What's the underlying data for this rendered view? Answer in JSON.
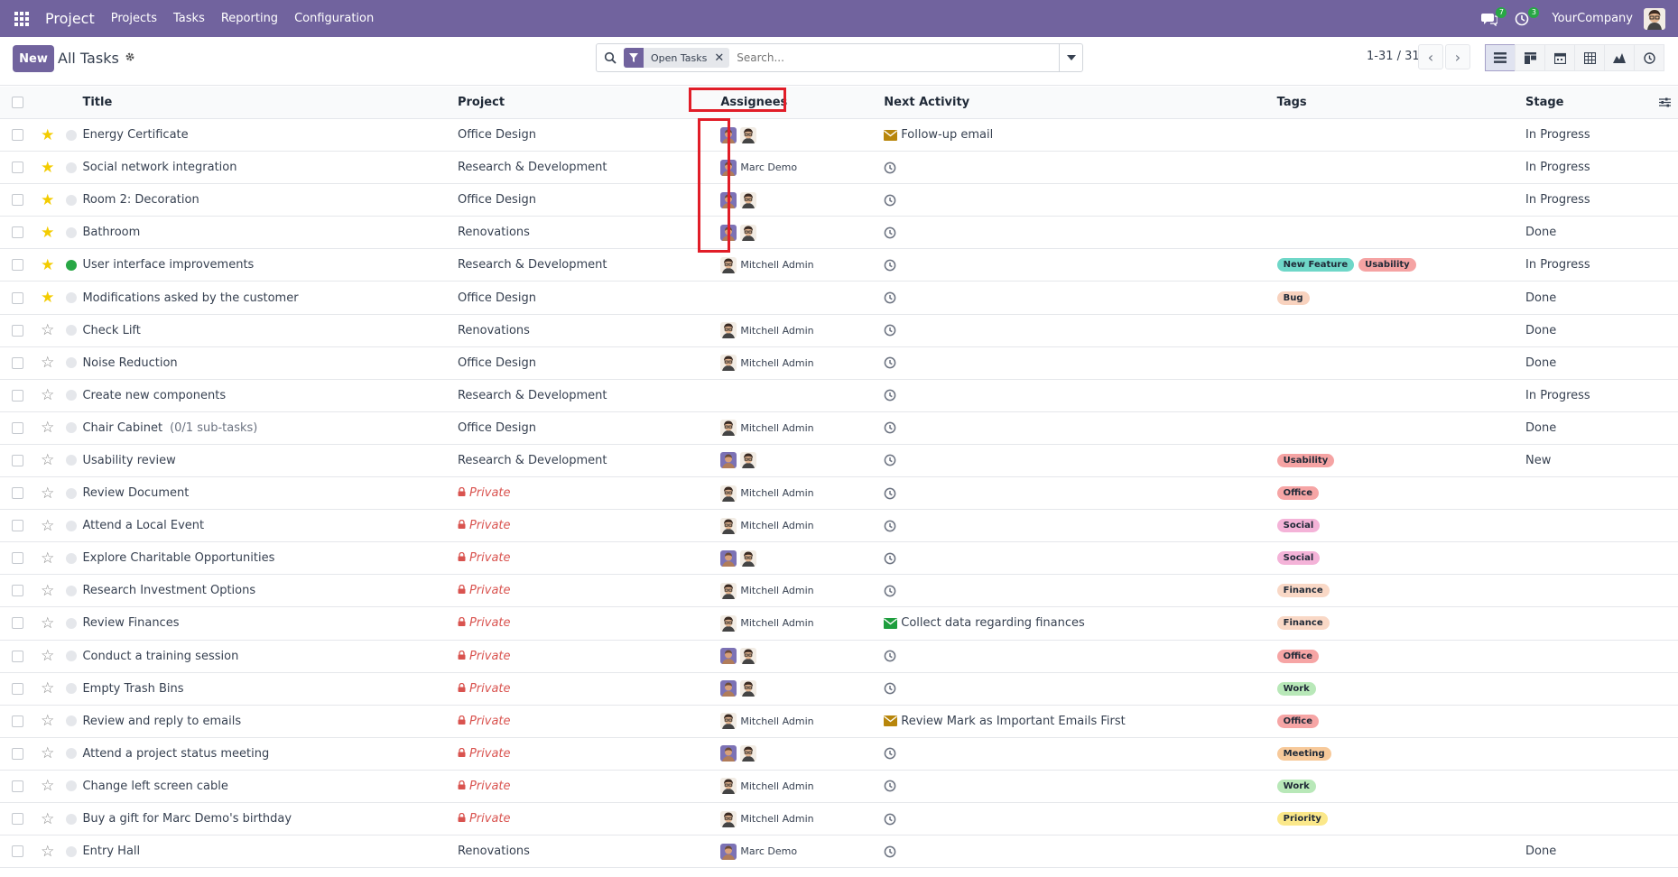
{
  "navbar": {
    "brand": "Project",
    "menu": [
      "Projects",
      "Tasks",
      "Reporting",
      "Configuration"
    ],
    "messages_count": "7",
    "activities_count": "3",
    "company": "YourCompany"
  },
  "control": {
    "new_label": "New",
    "breadcrumb": "All Tasks",
    "facet": "Open Tasks",
    "search_placeholder": "Search...",
    "pager": "1-31 / 31"
  },
  "table": {
    "headers": {
      "title": "Title",
      "project": "Project",
      "assignees": "Assignees",
      "activity": "Next Activity",
      "tags": "Tags",
      "stage": "Stage"
    },
    "rows": [
      {
        "starred": true,
        "state": "grey",
        "title": "Energy Certificate",
        "subtasks": "",
        "project": "Office Design",
        "private": false,
        "assignees": [
          "marc",
          "mitchell"
        ],
        "assignee_name": "",
        "activity": "Follow-up email",
        "activity_type": "mail-warning",
        "tags": [],
        "stage": "In Progress"
      },
      {
        "starred": true,
        "state": "grey",
        "title": "Social network integration",
        "subtasks": "",
        "project": "Research & Development",
        "private": false,
        "assignees": [
          "marc"
        ],
        "assignee_name": "Marc Demo",
        "activity": "",
        "activity_type": "clock",
        "tags": [],
        "stage": "In Progress"
      },
      {
        "starred": true,
        "state": "grey",
        "title": "Room 2: Decoration",
        "subtasks": "",
        "project": "Office Design",
        "private": false,
        "assignees": [
          "marc",
          "mitchell"
        ],
        "assignee_name": "",
        "activity": "",
        "activity_type": "clock",
        "tags": [],
        "stage": "In Progress"
      },
      {
        "starred": true,
        "state": "grey",
        "title": "Bathroom",
        "subtasks": "",
        "project": "Renovations",
        "private": false,
        "assignees": [
          "marc",
          "mitchell"
        ],
        "assignee_name": "",
        "activity": "",
        "activity_type": "clock",
        "tags": [],
        "stage": "Done"
      },
      {
        "starred": true,
        "state": "green",
        "title": "User interface improvements",
        "subtasks": "",
        "project": "Research & Development",
        "private": false,
        "assignees": [
          "mitchell"
        ],
        "assignee_name": "Mitchell Admin",
        "activity": "",
        "activity_type": "clock",
        "tags": [
          {
            "label": "New Feature",
            "color": "#6fd7c8"
          },
          {
            "label": "Usability",
            "color": "#f5a3a3"
          }
        ],
        "stage": "In Progress"
      },
      {
        "starred": true,
        "state": "grey",
        "title": "Modifications asked by the customer",
        "subtasks": "",
        "project": "Office Design",
        "private": false,
        "assignees": [],
        "assignee_name": "",
        "activity": "",
        "activity_type": "clock",
        "tags": [
          {
            "label": "Bug",
            "color": "#f8d2be"
          }
        ],
        "stage": "Done"
      },
      {
        "starred": false,
        "state": "grey",
        "title": "Check Lift",
        "subtasks": "",
        "project": "Renovations",
        "private": false,
        "assignees": [
          "mitchell"
        ],
        "assignee_name": "Mitchell Admin",
        "activity": "",
        "activity_type": "clock",
        "tags": [],
        "stage": "Done"
      },
      {
        "starred": false,
        "state": "grey",
        "title": "Noise Reduction",
        "subtasks": "",
        "project": "Office Design",
        "private": false,
        "assignees": [
          "mitchell"
        ],
        "assignee_name": "Mitchell Admin",
        "activity": "",
        "activity_type": "clock",
        "tags": [],
        "stage": "Done"
      },
      {
        "starred": false,
        "state": "grey",
        "title": "Create new components",
        "subtasks": "",
        "project": "Research & Development",
        "private": false,
        "assignees": [],
        "assignee_name": "",
        "activity": "",
        "activity_type": "clock",
        "tags": [],
        "stage": "In Progress"
      },
      {
        "starred": false,
        "state": "grey",
        "title": "Chair Cabinet",
        "subtasks": "(0/1 sub-tasks)",
        "project": "Office Design",
        "private": false,
        "assignees": [
          "mitchell"
        ],
        "assignee_name": "Mitchell Admin",
        "activity": "",
        "activity_type": "clock",
        "tags": [],
        "stage": "Done"
      },
      {
        "starred": false,
        "state": "grey",
        "title": "Usability review",
        "subtasks": "",
        "project": "Research & Development",
        "private": false,
        "assignees": [
          "marc",
          "mitchell"
        ],
        "assignee_name": "",
        "activity": "",
        "activity_type": "clock",
        "tags": [
          {
            "label": "Usability",
            "color": "#f5a3a3"
          }
        ],
        "stage": "New"
      },
      {
        "starred": false,
        "state": "grey",
        "title": "Review Document",
        "subtasks": "",
        "project": "Private",
        "private": true,
        "assignees": [
          "mitchell"
        ],
        "assignee_name": "Mitchell Admin",
        "activity": "",
        "activity_type": "clock",
        "tags": [
          {
            "label": "Office",
            "color": "#f6a5a5"
          }
        ],
        "stage": ""
      },
      {
        "starred": false,
        "state": "grey",
        "title": "Attend a Local Event",
        "subtasks": "",
        "project": "Private",
        "private": true,
        "assignees": [
          "mitchell"
        ],
        "assignee_name": "Mitchell Admin",
        "activity": "",
        "activity_type": "clock",
        "tags": [
          {
            "label": "Social",
            "color": "#f4b3d8"
          }
        ],
        "stage": ""
      },
      {
        "starred": false,
        "state": "grey",
        "title": "Explore Charitable Opportunities",
        "subtasks": "",
        "project": "Private",
        "private": true,
        "assignees": [
          "marc",
          "mitchell"
        ],
        "assignee_name": "",
        "activity": "",
        "activity_type": "clock",
        "tags": [
          {
            "label": "Social",
            "color": "#f4b3d8"
          }
        ],
        "stage": ""
      },
      {
        "starred": false,
        "state": "grey",
        "title": "Research Investment Options",
        "subtasks": "",
        "project": "Private",
        "private": true,
        "assignees": [
          "mitchell"
        ],
        "assignee_name": "Mitchell Admin",
        "activity": "",
        "activity_type": "clock",
        "tags": [
          {
            "label": "Finance",
            "color": "#f9d8c6"
          }
        ],
        "stage": ""
      },
      {
        "starred": false,
        "state": "grey",
        "title": "Review Finances",
        "subtasks": "",
        "project": "Private",
        "private": true,
        "assignees": [
          "mitchell"
        ],
        "assignee_name": "Mitchell Admin",
        "activity": "Collect data regarding finances",
        "activity_type": "mail-success",
        "tags": [
          {
            "label": "Finance",
            "color": "#f9d8c6"
          }
        ],
        "stage": ""
      },
      {
        "starred": false,
        "state": "grey",
        "title": "Conduct a training session",
        "subtasks": "",
        "project": "Private",
        "private": true,
        "assignees": [
          "marc",
          "mitchell"
        ],
        "assignee_name": "",
        "activity": "",
        "activity_type": "clock",
        "tags": [
          {
            "label": "Office",
            "color": "#f6a5a5"
          }
        ],
        "stage": ""
      },
      {
        "starred": false,
        "state": "grey",
        "title": "Empty Trash Bins",
        "subtasks": "",
        "project": "Private",
        "private": true,
        "assignees": [
          "marc",
          "mitchell"
        ],
        "assignee_name": "",
        "activity": "",
        "activity_type": "clock",
        "tags": [
          {
            "label": "Work",
            "color": "#b8e8b8"
          }
        ],
        "stage": ""
      },
      {
        "starred": false,
        "state": "grey",
        "title": "Review and reply to emails",
        "subtasks": "",
        "project": "Private",
        "private": true,
        "assignees": [
          "mitchell"
        ],
        "assignee_name": "Mitchell Admin",
        "activity": "Review Mark as Important Emails First",
        "activity_type": "mail-warning",
        "tags": [
          {
            "label": "Office",
            "color": "#f6a5a5"
          }
        ],
        "stage": ""
      },
      {
        "starred": false,
        "state": "grey",
        "title": "Attend a project status meeting",
        "subtasks": "",
        "project": "Private",
        "private": true,
        "assignees": [
          "marc",
          "mitchell"
        ],
        "assignee_name": "",
        "activity": "",
        "activity_type": "clock",
        "tags": [
          {
            "label": "Meeting",
            "color": "#f7c99a"
          }
        ],
        "stage": ""
      },
      {
        "starred": false,
        "state": "grey",
        "title": "Change left screen cable",
        "subtasks": "",
        "project": "Private",
        "private": true,
        "assignees": [
          "mitchell"
        ],
        "assignee_name": "Mitchell Admin",
        "activity": "",
        "activity_type": "clock",
        "tags": [
          {
            "label": "Work",
            "color": "#b8e8b8"
          }
        ],
        "stage": ""
      },
      {
        "starred": false,
        "state": "grey",
        "title": "Buy a gift for Marc Demo's birthday",
        "subtasks": "",
        "project": "Private",
        "private": true,
        "assignees": [
          "mitchell"
        ],
        "assignee_name": "Mitchell Admin",
        "activity": "",
        "activity_type": "clock",
        "tags": [
          {
            "label": "Priority",
            "color": "#fbe88a"
          }
        ],
        "stage": ""
      },
      {
        "starred": false,
        "state": "grey",
        "title": "Entry Hall",
        "subtasks": "",
        "project": "Renovations",
        "private": false,
        "assignees": [
          "marc"
        ],
        "assignee_name": "Marc Demo",
        "activity": "",
        "activity_type": "clock",
        "tags": [],
        "stage": "Done"
      }
    ]
  },
  "colors": {
    "brand": "#71639e",
    "highlight": "#e11d28",
    "star": "#f3cc00",
    "private": "#d9534f"
  }
}
